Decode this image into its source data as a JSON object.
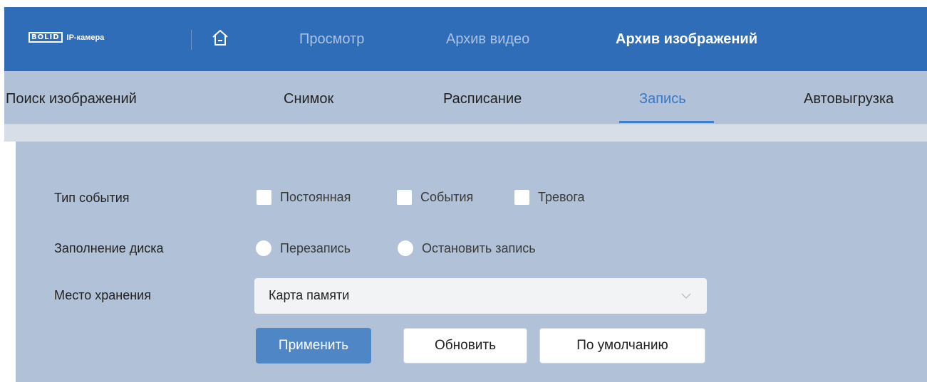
{
  "header": {
    "logo_box": "BOLID",
    "logo_text": "IP-камера",
    "home_icon": "home-icon",
    "nav": [
      {
        "label": "Просмотр",
        "active": false
      },
      {
        "label": "Архив видео",
        "active": false
      },
      {
        "label": "Архив изображений",
        "active": true
      }
    ]
  },
  "subnav": {
    "tabs": [
      {
        "label": "Поиск изображений",
        "active": false
      },
      {
        "label": "Снимок",
        "active": false
      },
      {
        "label": "Расписание",
        "active": false
      },
      {
        "label": "Запись",
        "active": true
      },
      {
        "label": "Автовыгрузка",
        "active": false
      }
    ]
  },
  "form": {
    "event_type": {
      "label": "Тип события",
      "options": [
        {
          "label": "Постоянная",
          "checked": false
        },
        {
          "label": "События",
          "checked": false
        },
        {
          "label": "Тревога",
          "checked": false
        }
      ]
    },
    "disk_full": {
      "label": "Заполнение диска",
      "options": [
        {
          "label": "Перезапись",
          "selected": false
        },
        {
          "label": "Остановить запись",
          "selected": false
        }
      ]
    },
    "storage": {
      "label": "Место хранения",
      "value": "Карта памяти"
    },
    "buttons": {
      "apply": "Применить",
      "refresh": "Обновить",
      "default": "По умолчанию"
    }
  },
  "colors": {
    "header_bg": "#2f6db8",
    "subnav_bg": "#b0c1d8",
    "accent": "#3f7fcc",
    "primary_button": "#4f86c6"
  }
}
